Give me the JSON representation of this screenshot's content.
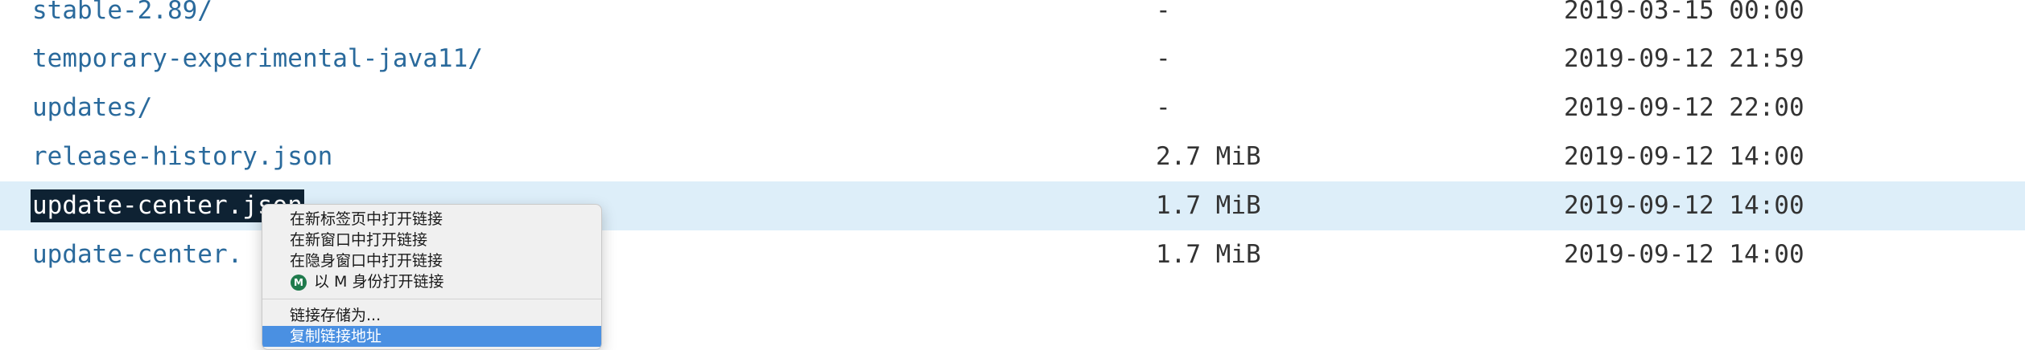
{
  "listing": {
    "rows": [
      {
        "name": "stable-2.89/",
        "size": "-",
        "date": "2019-03-15 00:00"
      },
      {
        "name": "temporary-experimental-java11/",
        "size": "-",
        "date": "2019-09-12 21:59"
      },
      {
        "name": "updates/",
        "size": "-",
        "date": "2019-09-12 22:00"
      },
      {
        "name": "release-history.json",
        "size": "2.7 MiB",
        "date": "2019-09-12 14:00"
      },
      {
        "name": "update-center.json",
        "size": "1.7 MiB",
        "date": "2019-09-12 14:00"
      },
      {
        "name": "update-center.",
        "size": "1.7 MiB",
        "date": "2019-09-12 14:00"
      }
    ]
  },
  "colors": {
    "link": "#2a6a9c",
    "row_highlight": "#ddeef9",
    "selection": "#0e2233",
    "menu_active": "#4a90e2"
  },
  "context_menu": {
    "items": [
      {
        "label": "在新标签页中打开链接"
      },
      {
        "label": "在新窗口中打开链接"
      },
      {
        "label": "在隐身窗口中打开链接"
      },
      {
        "label": "以 M 身份打开链接",
        "icon": "profile-avatar-icon",
        "icon_text": "M"
      },
      {
        "label": "链接存储为..."
      },
      {
        "label": "复制链接地址"
      }
    ]
  }
}
